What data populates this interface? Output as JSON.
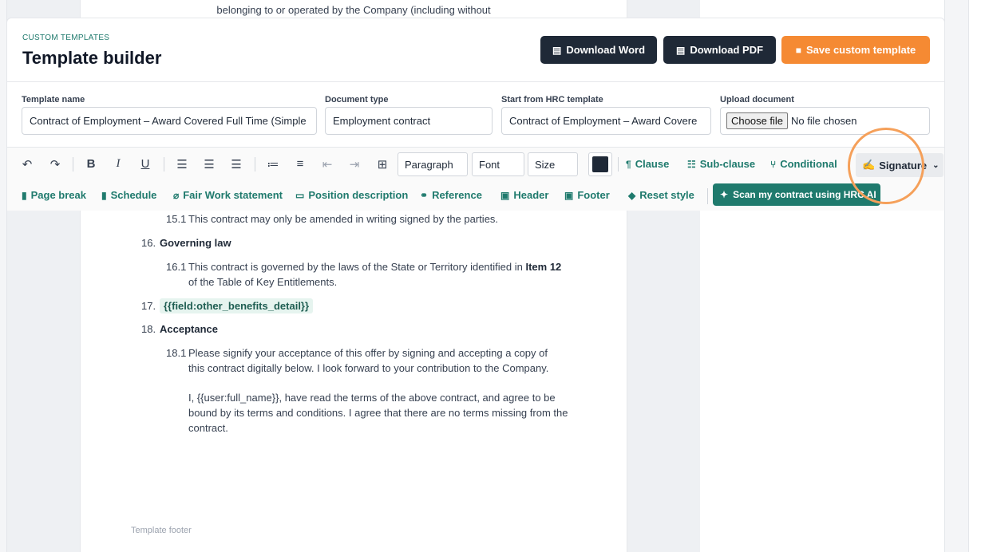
{
  "background_fragment": "belonging to or operated by the Company (including without",
  "header": {
    "eyebrow": "CUSTOM TEMPLATES",
    "title": "Template builder",
    "download_word": "Download Word",
    "download_pdf": "Download PDF",
    "save": "Save custom template"
  },
  "fields": {
    "template_name_label": "Template name",
    "template_name_value": "Contract of Employment – Award Covered Full Time (Simple",
    "document_type_label": "Document type",
    "document_type_value": "Employment contract",
    "start_from_label": "Start from HRC template",
    "start_from_value": "Contract of Employment – Award Covere",
    "upload_label": "Upload document",
    "choose_file": "Choose file",
    "no_file": "No file chosen"
  },
  "toolbar": {
    "paragraph": "Paragraph",
    "font": "Font",
    "size": "Size",
    "text_color": "#1f2937",
    "clause": "Clause",
    "sub_clause": "Sub-clause",
    "conditional": "Conditional",
    "signature": "Signature",
    "page_break": "Page break",
    "schedule": "Schedule",
    "fair_work": "Fair Work statement",
    "position_description": "Position description",
    "reference": "Reference",
    "header": "Header",
    "footer": "Footer",
    "reset_style": "Reset style",
    "scan": "Scan my contract using HRC AI"
  },
  "document": {
    "c15_1_num": "15.1",
    "c15_1_text": "This contract may only be amended in writing signed by the parties.",
    "c16_num": "16.",
    "c16_title": "Governing law",
    "c16_1_num": "16.1",
    "c16_1_text_a": "This contract is governed by the laws of the State or Territory identified in",
    "c16_1_item": "Item 12",
    "c16_1_text_b": "of the Table of Key Entitlements.",
    "c17_num": "17.",
    "c17_field": "{{field:other_benefits_detail}}",
    "c18_num": "18.",
    "c18_title": "Acceptance",
    "c18_1_num": "18.1",
    "c18_1_line1": "Please signify your acceptance of this offer by signing and accepting a copy of",
    "c18_1_line2": "this contract digitally below.  I look forward to your contribution to the Company.",
    "c18_p2_line1": "I, {{user:full_name}}, have read the terms of the above contract, and agree to be",
    "c18_p2_line2": "bound by its terms and conditions. I agree that there are no terms missing from the",
    "c18_p2_line3": "contract.",
    "footer_label": "Template footer"
  }
}
